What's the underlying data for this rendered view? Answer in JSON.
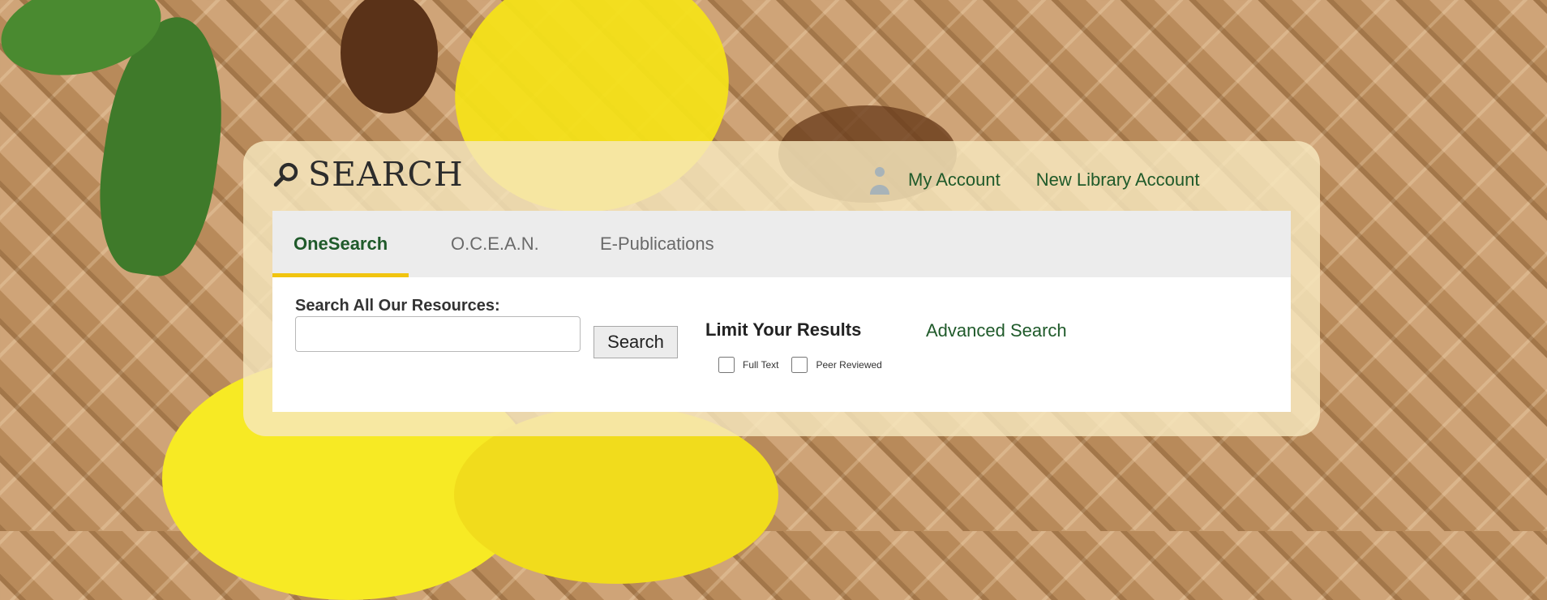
{
  "search_widget": {
    "title": "SEARCH",
    "account_links": {
      "my_account": "My Account",
      "new_library_account": "New Library Account"
    },
    "tabs": [
      {
        "label": "OneSearch",
        "active": true
      },
      {
        "label": "O.C.E.A.N.",
        "active": false
      },
      {
        "label": "E-Publications",
        "active": false
      }
    ],
    "form": {
      "search_label": "Search All Our Resources:",
      "search_input_value": "",
      "search_button_label": "Search",
      "limit_label": "Limit Your Results",
      "advanced_search_label": "Advanced Search",
      "filters": [
        {
          "label": "Full Text",
          "checked": false
        },
        {
          "label": "Peer Reviewed",
          "checked": false
        }
      ]
    }
  },
  "icons": {
    "search": "search-icon",
    "account": "person-icon"
  },
  "colors": {
    "link_green": "#1f5a2a",
    "tab_underline": "#f1c40f",
    "panel_cream": "#f6e8be",
    "tabbar_gray": "#ececec"
  }
}
